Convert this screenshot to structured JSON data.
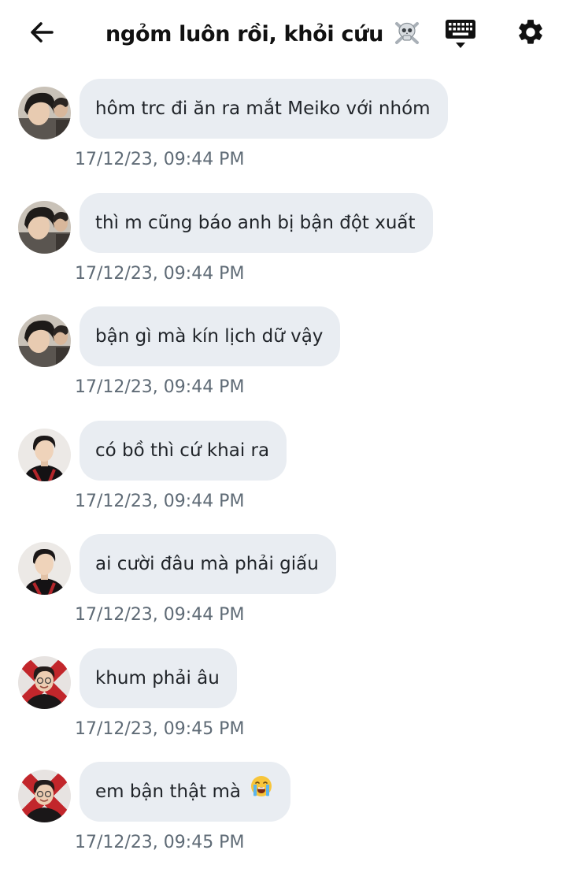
{
  "header": {
    "title": "ngỏm luôn rồi, khỏi cứu",
    "title_emoji": "☠️",
    "back_icon": "arrow-left-icon",
    "keyboard_icon": "keyboard-icon",
    "settings_icon": "gear-icon"
  },
  "messages": [
    {
      "text": "hôm trc đi ăn ra mắt Meiko với nhóm",
      "time": "17/12/23, 09:44 PM",
      "avatar": "avatar-a"
    },
    {
      "text": "thì m cũng báo anh bị bận đột xuất",
      "time": "17/12/23, 09:44 PM",
      "avatar": "avatar-a"
    },
    {
      "text": "bận gì mà kín lịch dữ vậy",
      "time": "17/12/23, 09:44 PM",
      "avatar": "avatar-a"
    },
    {
      "text": "có bồ thì cứ khai ra",
      "time": "17/12/23, 09:44 PM",
      "avatar": "avatar-b"
    },
    {
      "text": "ai cười đâu mà phải giấu",
      "time": "17/12/23, 09:44 PM",
      "avatar": "avatar-b"
    },
    {
      "text": "khum phải âu",
      "time": "17/12/23, 09:45 PM",
      "avatar": "avatar-c"
    },
    {
      "text": "em bận thật mà",
      "emoji": "😭",
      "time": "17/12/23, 09:45 PM",
      "avatar": "avatar-c"
    }
  ],
  "colors": {
    "bubble": "#e9edf2",
    "timestamp": "#5f6b76",
    "background": "#ffffff"
  }
}
